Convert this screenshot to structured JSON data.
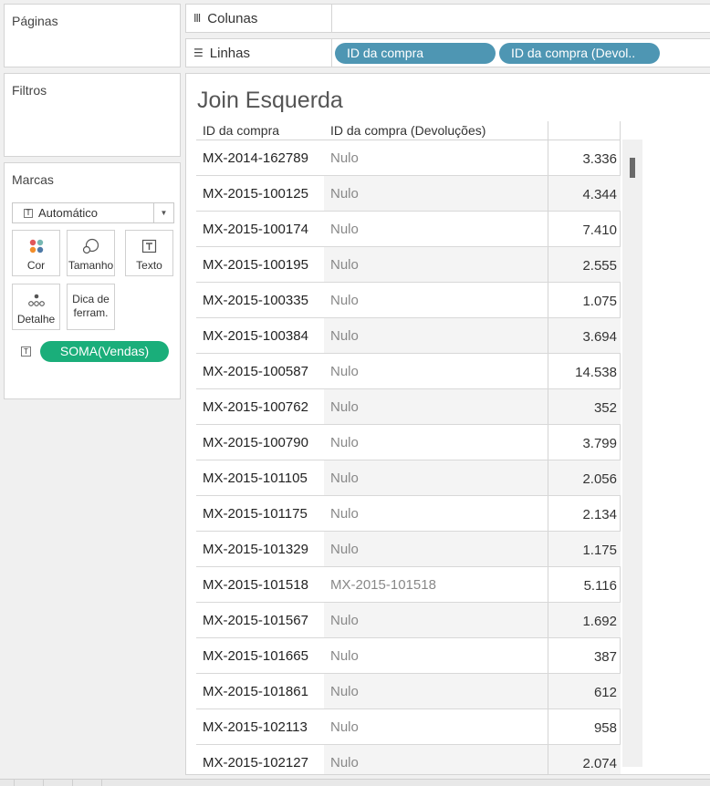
{
  "panels": {
    "paginas": "Páginas",
    "filtros": "Filtros",
    "marcas": "Marcas"
  },
  "marks": {
    "type": "Automático",
    "buttons": {
      "cor": "Cor",
      "tamanho": "Tamanho",
      "texto": "Texto",
      "detalhe": "Detalhe",
      "dica": "Dica de ferram."
    },
    "field_pill": "SOMA(Vendas)"
  },
  "shelves": {
    "colunas": "Colunas",
    "linhas": "Linhas",
    "linhas_pills": [
      "ID da compra",
      "ID da compra (Devol.."
    ]
  },
  "view": {
    "title": "Join Esquerda",
    "headers": [
      "ID da compra",
      "ID da compra (Devoluções)"
    ],
    "rows": [
      {
        "id": "MX-2014-162789",
        "dev": "Nulo",
        "value": "3.336"
      },
      {
        "id": "MX-2015-100125",
        "dev": "Nulo",
        "value": "4.344"
      },
      {
        "id": "MX-2015-100174",
        "dev": "Nulo",
        "value": "7.410"
      },
      {
        "id": "MX-2015-100195",
        "dev": "Nulo",
        "value": "2.555"
      },
      {
        "id": "MX-2015-100335",
        "dev": "Nulo",
        "value": "1.075"
      },
      {
        "id": "MX-2015-100384",
        "dev": "Nulo",
        "value": "3.694"
      },
      {
        "id": "MX-2015-100587",
        "dev": "Nulo",
        "value": "14.538"
      },
      {
        "id": "MX-2015-100762",
        "dev": "Nulo",
        "value": "352"
      },
      {
        "id": "MX-2015-100790",
        "dev": "Nulo",
        "value": "3.799"
      },
      {
        "id": "MX-2015-101105",
        "dev": "Nulo",
        "value": "2.056"
      },
      {
        "id": "MX-2015-101175",
        "dev": "Nulo",
        "value": "2.134"
      },
      {
        "id": "MX-2015-101329",
        "dev": "Nulo",
        "value": "1.175"
      },
      {
        "id": "MX-2015-101518",
        "dev": "MX-2015-101518",
        "value": "5.116"
      },
      {
        "id": "MX-2015-101567",
        "dev": "Nulo",
        "value": "1.692"
      },
      {
        "id": "MX-2015-101665",
        "dev": "Nulo",
        "value": "387"
      },
      {
        "id": "MX-2015-101861",
        "dev": "Nulo",
        "value": "612"
      },
      {
        "id": "MX-2015-102113",
        "dev": "Nulo",
        "value": "958"
      },
      {
        "id": "MX-2015-102127",
        "dev": "Nulo",
        "value": "2.074"
      }
    ]
  },
  "colors": {
    "pill_dimension": "#4e96b3",
    "pill_measure": "#1aae7a"
  },
  "icons": {
    "colunas": "columns-icon",
    "linhas": "rows-icon",
    "cor": "color-dots-icon",
    "tamanho": "size-icon",
    "texto": "text-icon",
    "detalhe": "detail-icon"
  }
}
